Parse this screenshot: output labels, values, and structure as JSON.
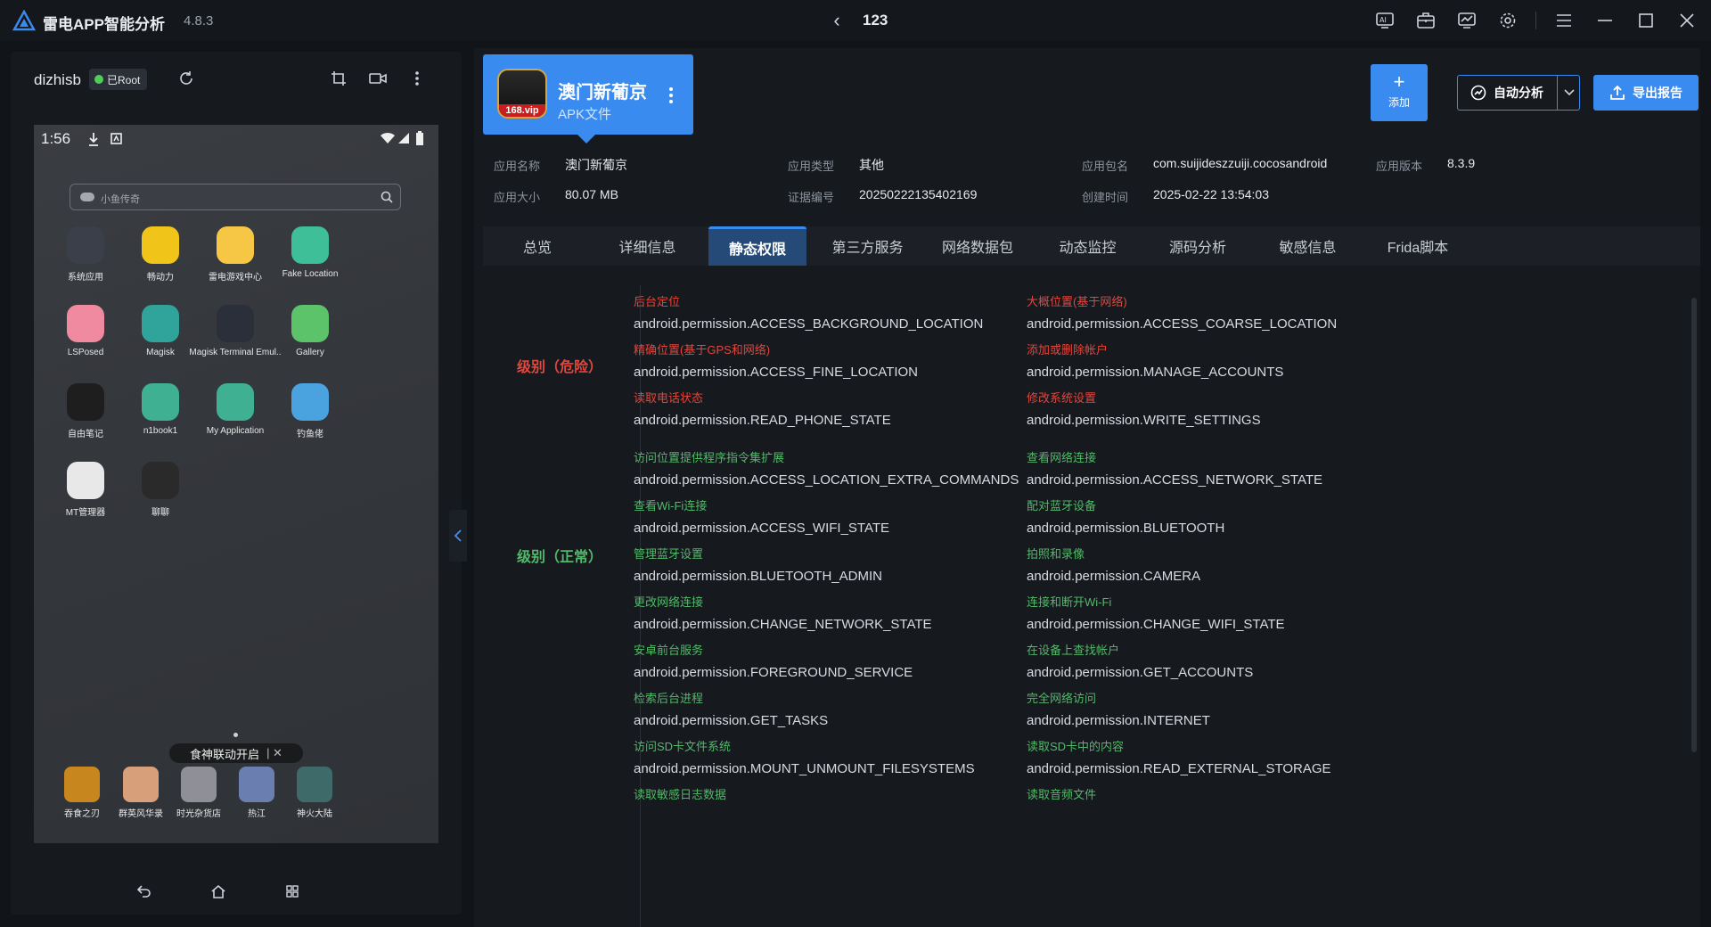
{
  "titlebar": {
    "app_name": "雷电APP智能分析",
    "version": "4.8.3",
    "doc_title": "123"
  },
  "device": {
    "name": "dizhisb",
    "root_label": "已Root",
    "status_time": "1:56",
    "search_placeholder": "小鱼传奇",
    "apps": [
      {
        "label": "系统应用",
        "color": "#3a3f4a"
      },
      {
        "label": "畅动力",
        "color": "#f0c419"
      },
      {
        "label": "雷电游戏中心",
        "color": "#f6c744"
      },
      {
        "label": "Fake Location",
        "color": "#3fbf97"
      },
      {
        "label": "LSPosed",
        "color": "#f08aa0"
      },
      {
        "label": "Magisk",
        "color": "#30a39a"
      },
      {
        "label": "Magisk Terminal Emul..",
        "color": "#2a2f3a"
      },
      {
        "label": "Gallery",
        "color": "#5cc36b"
      },
      {
        "label": "自由笔记",
        "color": "#1e1e1e"
      },
      {
        "label": "n1book1",
        "color": "#3fb092"
      },
      {
        "label": "My Application",
        "color": "#3fb092"
      },
      {
        "label": "钓鱼佬",
        "color": "#4aa3df"
      },
      {
        "label": "MT管理器",
        "color": "#e8e8e8"
      },
      {
        "label": "聊聊",
        "color": "#2a2a2a"
      }
    ],
    "toast": "食神联动开启",
    "dock": [
      {
        "label": "吞食之刃",
        "color": "#c8861e"
      },
      {
        "label": "群英风华录",
        "color": "#d8a07a"
      },
      {
        "label": "时光杂货店",
        "color": "#8f8f98"
      },
      {
        "label": "热江",
        "color": "#6a7fb0"
      },
      {
        "label": "神火大陆",
        "color": "#3f6a6a"
      }
    ]
  },
  "app_card": {
    "name": "澳门新葡京",
    "type": "APK文件",
    "icon_text": "168.vip"
  },
  "actions": {
    "add_label": "添加",
    "auto_label": "自动分析",
    "export_label": "导出报告"
  },
  "info": {
    "name_label": "应用名称",
    "name_value": "澳门新葡京",
    "type_label": "应用类型",
    "type_value": "其他",
    "pkg_label": "应用包名",
    "pkg_value": "com.suijideszzuiji.cocosandroid",
    "ver_label": "应用版本",
    "ver_value": "8.3.9",
    "size_label": "应用大小",
    "size_value": "80.07 MB",
    "cert_label": "证据编号",
    "cert_value": "20250222135402169",
    "time_label": "创建时间",
    "time_value": "2025-02-22 13:54:03"
  },
  "tabs": [
    "总览",
    "详细信息",
    "静态权限",
    "第三方服务",
    "网络数据包",
    "动态监控",
    "源码分析",
    "敏感信息",
    "Frida脚本"
  ],
  "active_tab": "静态权限",
  "levels": {
    "danger": "级别（危险）",
    "normal": "级别（正常）"
  },
  "danger_perms": [
    {
      "name": "后台定位",
      "id": "android.permission.ACCESS_BACKGROUND_LOCATION"
    },
    {
      "name": "大概位置(基于网络)",
      "id": "android.permission.ACCESS_COARSE_LOCATION"
    },
    {
      "name": "精确位置(基于GPS和网络)",
      "id": "android.permission.ACCESS_FINE_LOCATION"
    },
    {
      "name": "添加或删除帐户",
      "id": "android.permission.MANAGE_ACCOUNTS"
    },
    {
      "name": "读取电话状态",
      "id": "android.permission.READ_PHONE_STATE"
    },
    {
      "name": "修改系统设置",
      "id": "android.permission.WRITE_SETTINGS"
    }
  ],
  "normal_perms": [
    {
      "name": "访问位置提供程序指令集扩展",
      "id": "android.permission.ACCESS_LOCATION_EXTRA_COMMANDS"
    },
    {
      "name": "查看网络连接",
      "id": "android.permission.ACCESS_NETWORK_STATE"
    },
    {
      "name": "查看Wi-Fi连接",
      "id": "android.permission.ACCESS_WIFI_STATE"
    },
    {
      "name": "配对蓝牙设备",
      "id": "android.permission.BLUETOOTH"
    },
    {
      "name": "管理蓝牙设置",
      "id": "android.permission.BLUETOOTH_ADMIN"
    },
    {
      "name": "拍照和录像",
      "id": "android.permission.CAMERA"
    },
    {
      "name": "更改网络连接",
      "id": "android.permission.CHANGE_NETWORK_STATE"
    },
    {
      "name": "连接和断开Wi-Fi",
      "id": "android.permission.CHANGE_WIFI_STATE"
    },
    {
      "name": "安卓前台服务",
      "id": "android.permission.FOREGROUND_SERVICE"
    },
    {
      "name": "在设备上查找帐户",
      "id": "android.permission.GET_ACCOUNTS"
    },
    {
      "name": "检索后台进程",
      "id": "android.permission.GET_TASKS"
    },
    {
      "name": "完全网络访问",
      "id": "android.permission.INTERNET"
    },
    {
      "name": "访问SD卡文件系统",
      "id": "android.permission.MOUNT_UNMOUNT_FILESYSTEMS"
    },
    {
      "name": "读取SD卡中的内容",
      "id": "android.permission.READ_EXTERNAL_STORAGE"
    },
    {
      "name": "读取敏感日志数据",
      "id": ""
    },
    {
      "name": "读取音频文件",
      "id": ""
    }
  ]
}
